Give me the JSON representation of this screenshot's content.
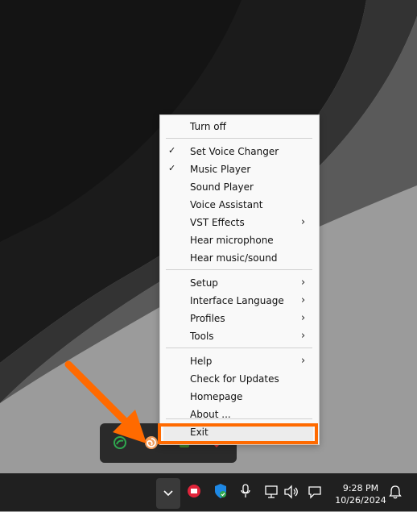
{
  "menu": {
    "items": [
      {
        "label": "Turn off",
        "checked": false,
        "submenu": false
      },
      {
        "label": "Set Voice Changer",
        "checked": true,
        "submenu": false
      },
      {
        "label": "Music Player",
        "checked": true,
        "submenu": false
      },
      {
        "label": "Sound Player",
        "checked": false,
        "submenu": false
      },
      {
        "label": "Voice Assistant",
        "checked": false,
        "submenu": false
      },
      {
        "label": "VST Effects",
        "checked": false,
        "submenu": true
      },
      {
        "label": "Hear microphone",
        "checked": false,
        "submenu": false
      },
      {
        "label": "Hear music/sound",
        "checked": false,
        "submenu": false
      },
      {
        "label": "Setup",
        "checked": false,
        "submenu": true
      },
      {
        "label": "Interface Language",
        "checked": false,
        "submenu": true
      },
      {
        "label": "Profiles",
        "checked": false,
        "submenu": true
      },
      {
        "label": "Tools",
        "checked": false,
        "submenu": true
      },
      {
        "label": "Help",
        "checked": false,
        "submenu": true
      },
      {
        "label": "Check for Updates",
        "checked": false,
        "submenu": false
      },
      {
        "label": "Homepage",
        "checked": false,
        "submenu": false
      },
      {
        "label": "About ...",
        "checked": false,
        "submenu": false
      },
      {
        "label": "Exit",
        "checked": false,
        "submenu": false
      }
    ],
    "check_glyph": "✓",
    "submenu_glyph": "›"
  },
  "taskbar": {
    "time": "9:28 PM",
    "date": "10/26/2024"
  },
  "colors": {
    "highlight": "#ff6a00",
    "taskbar": "#202020",
    "menu_bg": "#f9f9f9"
  },
  "icons": [
    "chevron-up-icon",
    "app-icon-red",
    "windows-security-icon",
    "microphone-icon",
    "network-icon",
    "speaker-icon",
    "chat-icon",
    "bell-icon",
    "voice-changer-icon",
    "green-app-icon"
  ]
}
